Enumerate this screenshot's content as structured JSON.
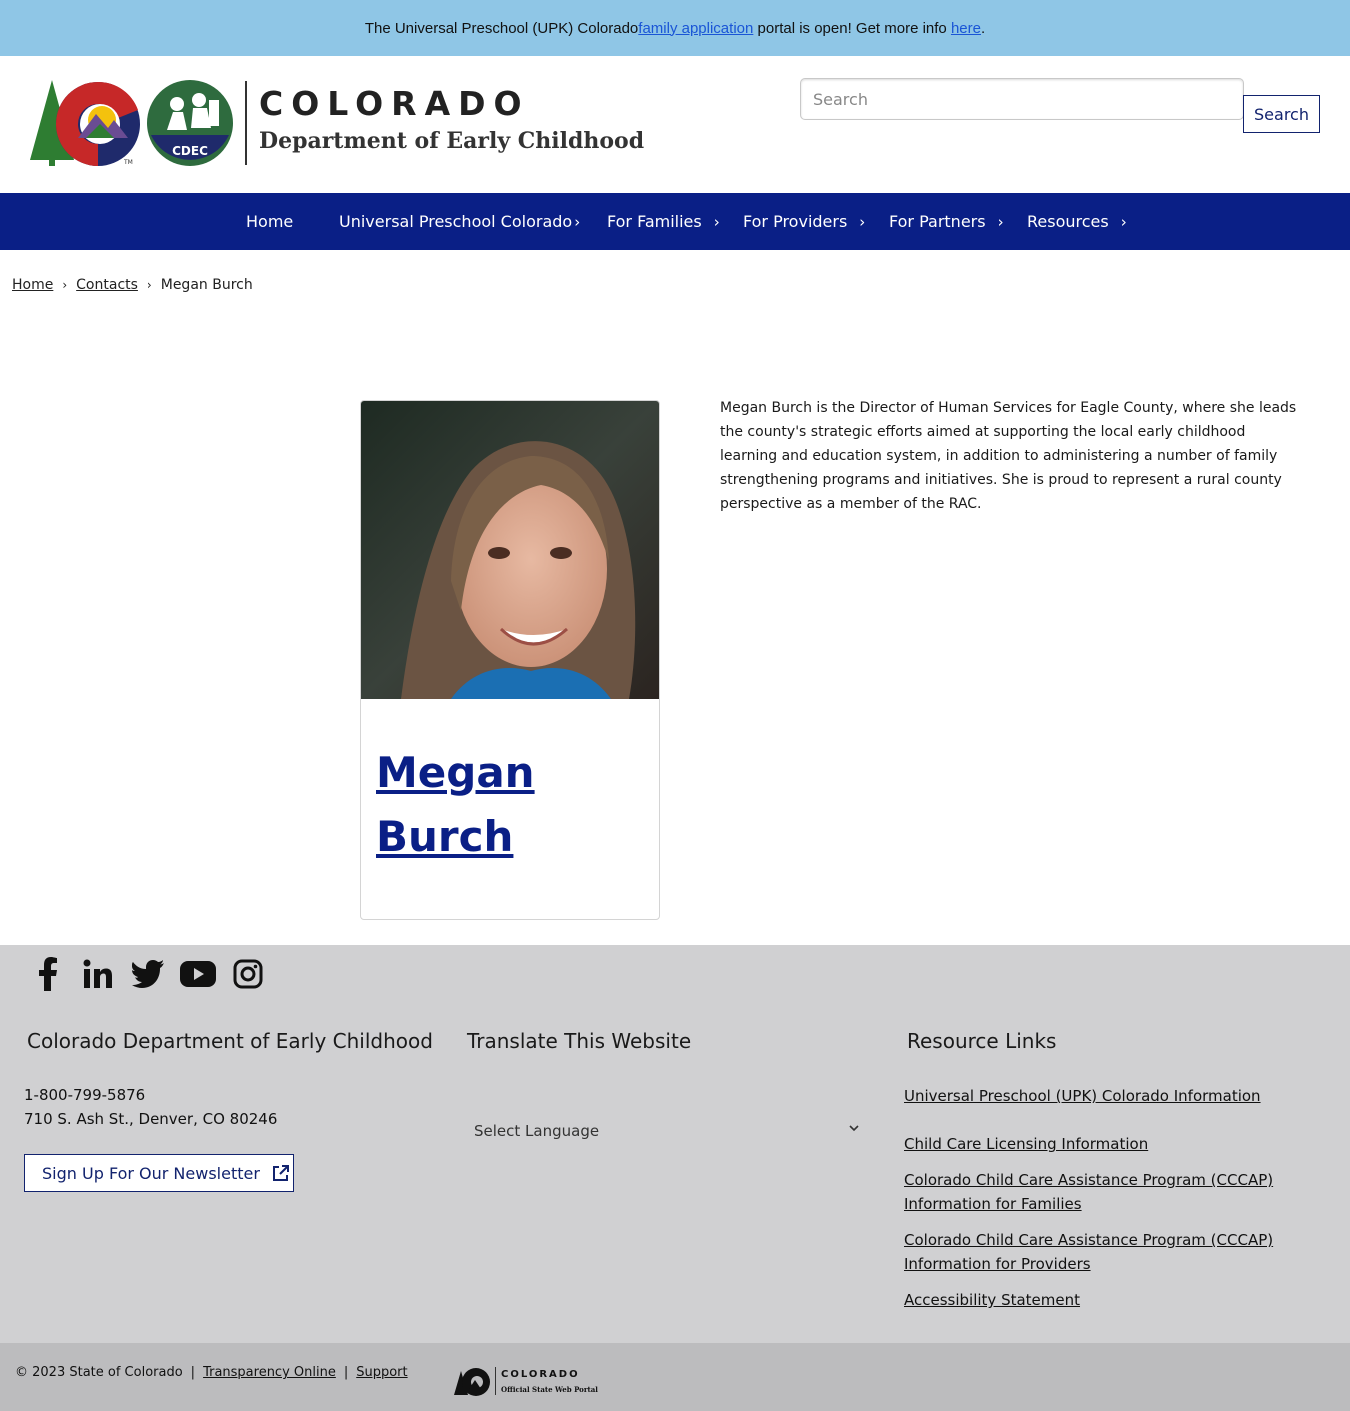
{
  "alert": {
    "text_before": "The Universal Preschool (UPK) Colorado ",
    "link1": "family application",
    "text_middle": " portal is open! Get more info ",
    "link2": "here",
    "text_after": "."
  },
  "header": {
    "brand_title": "COLORADO",
    "brand_subtitle": "Department of Early Childhood",
    "cdec_logo_text": "CDEC",
    "search_placeholder": "Search",
    "search_button": "Search"
  },
  "nav": {
    "items": [
      {
        "label": "Home"
      },
      {
        "label": "Universal Preschool Colorado"
      },
      {
        "label": "For Families"
      },
      {
        "label": "For Providers"
      },
      {
        "label": "For Partners"
      },
      {
        "label": "Resources"
      }
    ]
  },
  "breadcrumb": {
    "items": [
      "Home",
      "Contacts",
      "Megan Burch"
    ]
  },
  "profile": {
    "name_line1": "Megan",
    "name_line2": "Burch",
    "bio": "Megan Burch is the Director of Human Services for Eagle County, where she leads the county's strategic efforts aimed at supporting the local early childhood learning and education system, in addition to administering a number of family strengthening programs and initiatives. She is proud to represent a rural county perspective as a member of the RAC."
  },
  "footer": {
    "social_icons": [
      "facebook-icon",
      "linkedin-icon",
      "twitter-icon",
      "youtube-icon",
      "instagram-icon"
    ],
    "col1_heading": "Colorado Department of Early Childhood",
    "phone": "1-800-799-5876",
    "address": "710 S. Ash St., Denver, CO 80246",
    "newsletter_button": "Sign Up For Our Newsletter",
    "col2_heading": "Translate This Website",
    "language_select": "Select Language",
    "col3_heading": "Resource Links",
    "resource_links": [
      "Universal Preschool (UPK) Colorado Information",
      "Child Care Licensing Information",
      "Colorado Child Care Assistance Program (CCCAP) Information for Families",
      "Colorado Child Care Assistance Program (CCCAP) Information for Providers",
      "Accessibility Statement"
    ]
  },
  "bottom_bar": {
    "copyright": "© 2023 State of Colorado",
    "sep": "|",
    "link1": "Transparency Online",
    "link2": "Support",
    "portal_title": "COLORADO",
    "portal_subtitle": "Official State Web Portal"
  },
  "colors": {
    "alert_bg": "#8fc6e6",
    "nav_bg": "#0a1f86",
    "link_blue": "#0a1f86",
    "footer_bg": "#d0d0d2",
    "bottom_bar_bg": "#bcbcbe"
  }
}
